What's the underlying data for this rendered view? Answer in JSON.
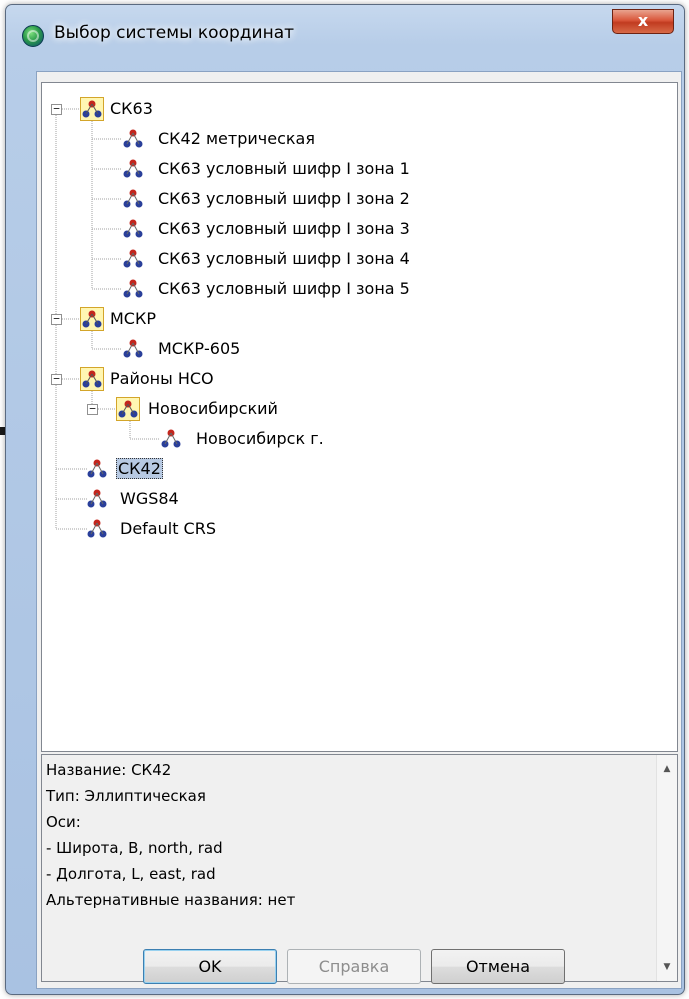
{
  "window": {
    "title": "Выбор системы координат",
    "close_label": "x"
  },
  "tree": {
    "nodes": [
      {
        "label": "СК63"
      },
      {
        "label": "СК42 метрическая"
      },
      {
        "label": "СК63 условный шифр I зона 1"
      },
      {
        "label": "СК63 условный шифр I зона 2"
      },
      {
        "label": "СК63 условный шифр I зона 3"
      },
      {
        "label": "СК63 условный шифр I зона 4"
      },
      {
        "label": "СК63 условный шифр I зона 5"
      },
      {
        "label": "МСКР"
      },
      {
        "label": "МСКР-605"
      },
      {
        "label": "Районы НСО"
      },
      {
        "label": "Новосибирский"
      },
      {
        "label": "Новосибирск г."
      },
      {
        "label": "СК42",
        "selected": true
      },
      {
        "label": "WGS84"
      },
      {
        "label": "Default CRS"
      }
    ]
  },
  "info": {
    "lines": [
      "Название: СК42",
      "Тип: Эллиптическая",
      "Оси:",
      "- Широта, B, north, rad",
      "- Долгота, L, east, rad",
      "Альтернативные названия: нет"
    ]
  },
  "buttons": {
    "ok": "OK",
    "help": "Справка",
    "cancel": "Отмена"
  },
  "icons": {
    "app": "globe-icon",
    "folder": "crs-folder-icon",
    "crs": "crs-nodes-icon",
    "expander": "minus-box-icon"
  }
}
